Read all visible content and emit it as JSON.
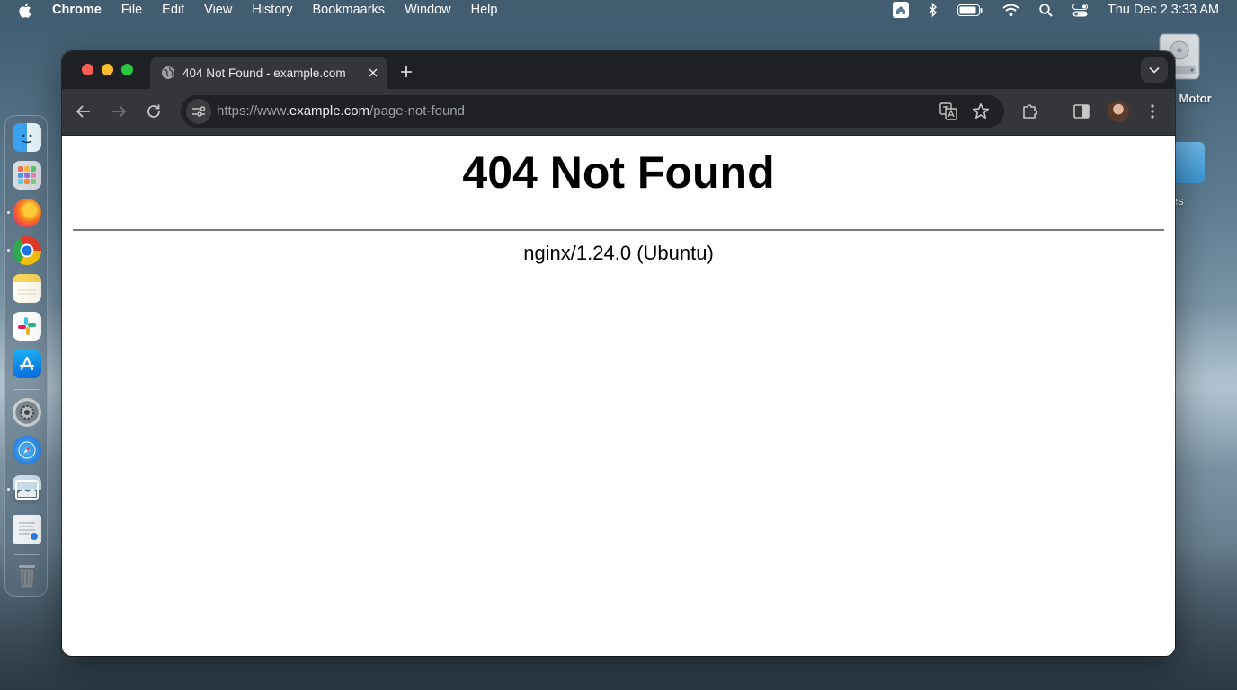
{
  "menubar": {
    "app_name": "Chrome",
    "items": [
      "File",
      "Edit",
      "View",
      "History",
      "Bookmaarks",
      "Window",
      "Help"
    ],
    "clock": "Thu Dec 2  3:33 AM"
  },
  "desktop": {
    "disk_label": "o Motor",
    "folder_label": "ies"
  },
  "dock": {
    "apps": [
      "finder-icon",
      "launchpad-icon",
      "firefox-icon",
      "chrome-icon",
      "notes-icon",
      "slack-icon",
      "app-store-icon",
      "system-settings-icon",
      "safari-icon",
      "preview-icon",
      "document-icon",
      "trash-icon"
    ]
  },
  "browser": {
    "tab_title": "404 Not Found - example.com",
    "url_scheme": "https://www.",
    "url_host": "example.com",
    "url_path": "/page-not-found"
  },
  "page": {
    "heading": "404 Not Found",
    "server_signature": "nginx/1.24.0 (Ubuntu)"
  },
  "colors": {
    "tabstrip": "#1f2023",
    "toolbar": "#35363a",
    "close": "#ff5f57",
    "minimize": "#febc2e",
    "maximize": "#28c840"
  }
}
